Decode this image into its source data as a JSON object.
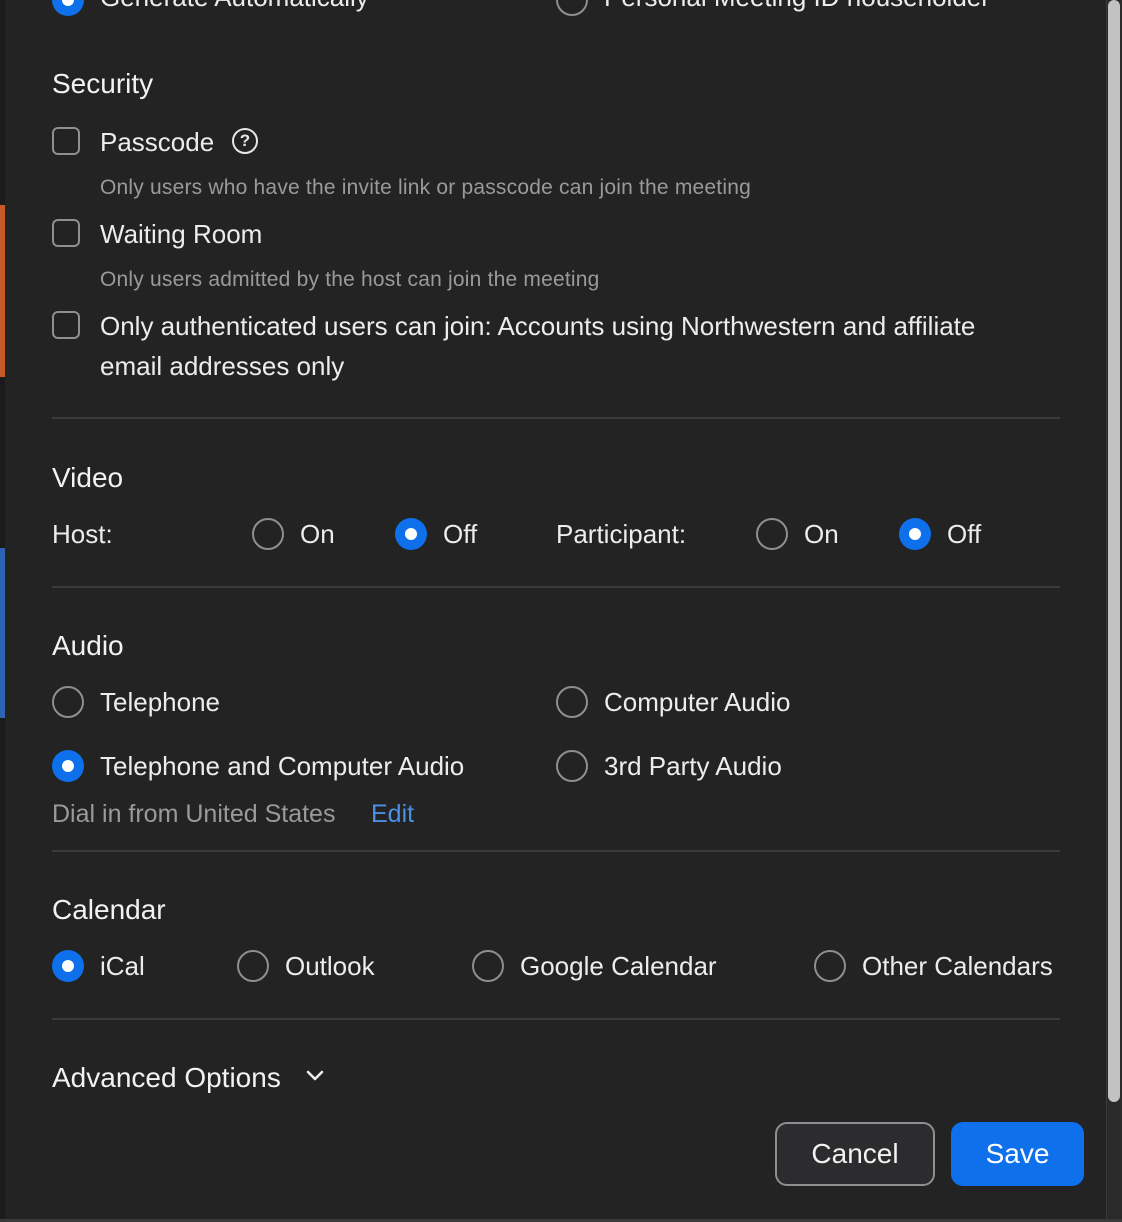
{
  "top_partial": {
    "generate_automatically_label": "Generate Automatically",
    "personal_meeting_id_label": "Personal Meeting ID householder"
  },
  "security": {
    "title": "Security",
    "passcode_label": "Passcode",
    "passcode_desc": "Only users who have the invite link or passcode can join the meeting",
    "waiting_room_label": "Waiting Room",
    "waiting_room_desc": "Only users admitted by the host can join the meeting",
    "auth_line1": "Only authenticated users can join: Accounts using Northwestern and affiliate",
    "auth_line2": "email addresses only"
  },
  "video": {
    "title": "Video",
    "host_label": "Host:",
    "participant_label": "Participant:",
    "on_label": "On",
    "off_label": "Off"
  },
  "audio": {
    "title": "Audio",
    "telephone": "Telephone",
    "computer_audio": "Computer Audio",
    "telephone_and_computer": "Telephone and Computer Audio",
    "third_party": "3rd Party Audio",
    "dial_in": "Dial in from United States",
    "edit_link": "Edit"
  },
  "calendar": {
    "title": "Calendar",
    "ical": "iCal",
    "outlook": "Outlook",
    "google": "Google Calendar",
    "other": "Other Calendars"
  },
  "advanced_options": "Advanced Options",
  "buttons": {
    "cancel": "Cancel",
    "save": "Save"
  },
  "colors": {
    "background": "#232324",
    "accent": "#0e71eb",
    "link": "#4a90e8",
    "muted_text": "#9a9a9d"
  }
}
